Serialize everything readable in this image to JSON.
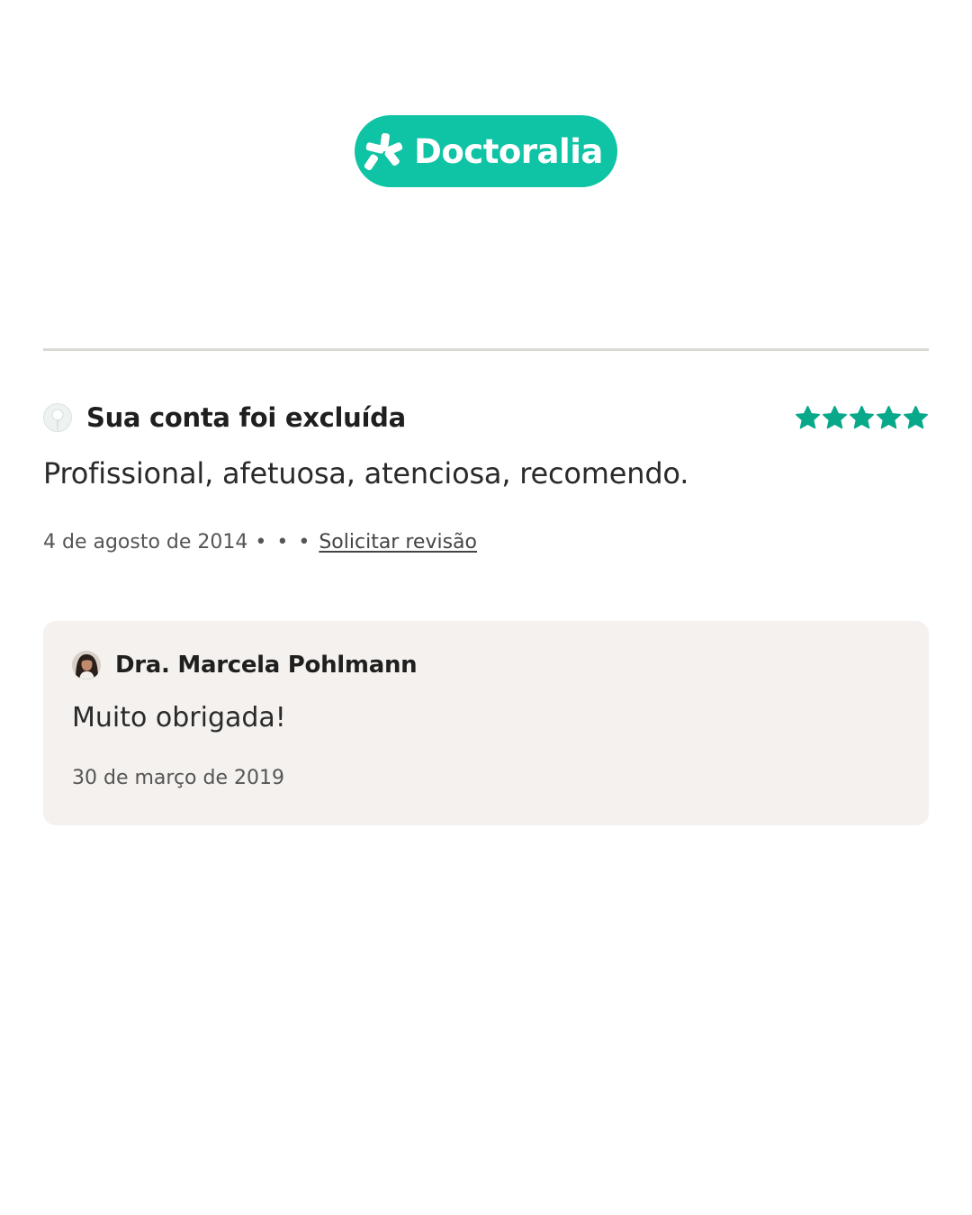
{
  "brand": {
    "name": "Doctoralia",
    "color": "#0fc3a5",
    "icon": "doctoralia-star-icon"
  },
  "review": {
    "author": "Sua conta foi excluída",
    "author_icon": "anonymous-avatar-icon",
    "rating": 5,
    "rating_max": 5,
    "star_color": "#08a88a",
    "text": "Profissional, afetuosa, atenciosa, recomendo.",
    "date": "4 de agosto de 2014",
    "dots": "• • •",
    "request_review_label": "Solicitar revisão"
  },
  "reply": {
    "author": "Dra. Marcela Pohlmann",
    "avatar_icon": "doctor-avatar",
    "text": "Muito obrigada!",
    "date": "30 de março de 2019",
    "background": "#f4f1ee"
  }
}
